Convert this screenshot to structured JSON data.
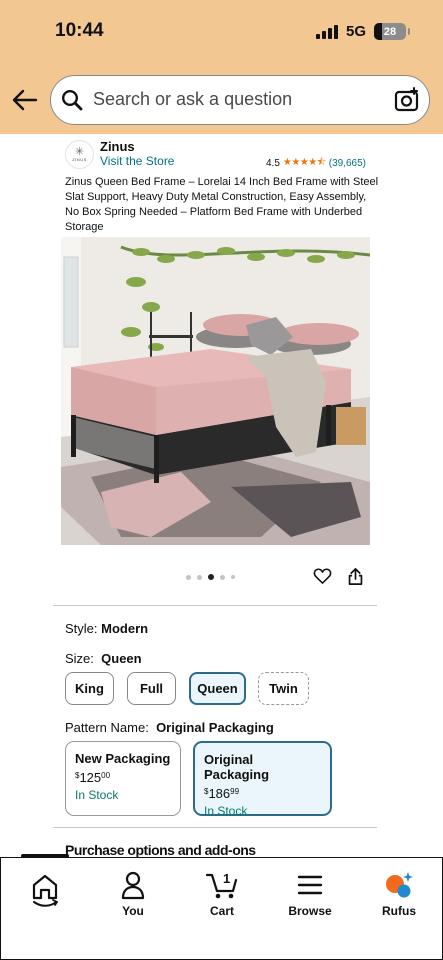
{
  "status_bar": {
    "time": "10:44",
    "network": "5G",
    "battery": "28"
  },
  "search": {
    "placeholder": "Search or ask a question"
  },
  "brand": {
    "logo_text": "ZINUS",
    "name": "Zinus",
    "store_link": "Visit the Store"
  },
  "rating": {
    "value": "4.5",
    "stars": "★★★★⯪",
    "count": "(39,665)"
  },
  "product": {
    "title": "Zinus Queen Bed Frame – Lorelai 14 Inch Bed Frame with Steel Slat Support, Heavy Duty Metal Construction, Easy Assembly, No Box Spring Needed – Platform Bed Frame with Underbed Storage",
    "image_count": 5,
    "active_image": 3
  },
  "style": {
    "label": "Style:",
    "value": "Modern"
  },
  "size": {
    "label": "Size:",
    "value": "Queen",
    "options": [
      {
        "label": "King",
        "state": "available"
      },
      {
        "label": "Full",
        "state": "available"
      },
      {
        "label": "Queen",
        "state": "selected"
      },
      {
        "label": "Twin",
        "state": "unavailable"
      }
    ]
  },
  "pattern": {
    "label": "Pattern Name:",
    "value": "Original Packaging",
    "options": [
      {
        "name": "New Packaging",
        "currency": "$",
        "dollars": "125",
        "cents": "00",
        "stock": "In Stock",
        "selected": false
      },
      {
        "name": "Original Packaging",
        "currency": "$",
        "dollars": "186",
        "cents": "99",
        "stock": "In Stock",
        "selected": true
      }
    ]
  },
  "purchase_section": {
    "title": "Purchase options and add-ons"
  },
  "bottom_nav": {
    "items": [
      {
        "label": "",
        "icon": "home-icon"
      },
      {
        "label": "You",
        "icon": "user-icon"
      },
      {
        "label": "Cart",
        "icon": "cart-icon",
        "badge": "1"
      },
      {
        "label": "Browse",
        "icon": "menu-icon"
      },
      {
        "label": "Rufus",
        "icon": "rufus-icon"
      }
    ]
  },
  "colors": {
    "header_bg": "#f3c792",
    "link": "#007185",
    "stock_green": "#067d62",
    "selected_border": "#2d6a8e",
    "selected_bg": "#eaf6fb",
    "star": "#e47911",
    "rufus_orange": "#f26b1d",
    "rufus_blue": "#1f8ad2"
  }
}
